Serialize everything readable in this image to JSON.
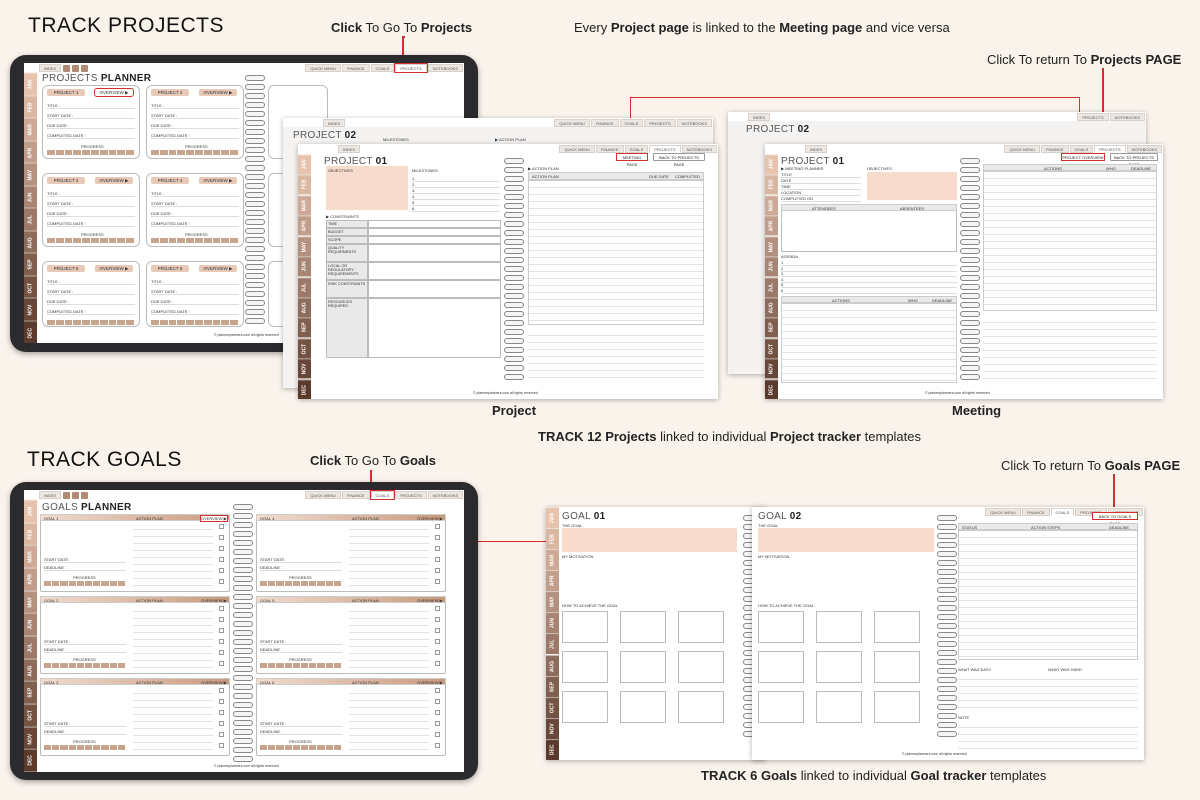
{
  "headings": {
    "projects": "TRACK PROJECTS",
    "goals": "TRACK GOALS"
  },
  "captions": {
    "click_projects_a": "Click",
    "click_projects_b": " To Go To ",
    "click_projects_c": "Projects",
    "linked_a": "Every ",
    "linked_b": "Project page",
    "linked_c": " is linked to the ",
    "linked_d": "Meeting page",
    "linked_e": " and vice versa",
    "return_projects_a": "Click To return To ",
    "return_projects_b": "Projects PAGE",
    "label_project": "Project",
    "label_meeting": "Meeting",
    "track12_a": "TRACK 12 ",
    "track12_b": "Projects",
    "track12_c": " linked to individual ",
    "track12_d": "Project tracker",
    "track12_e": " templates",
    "click_goals_a": "Click",
    "click_goals_b": " To Go To ",
    "click_goals_c": "Goals",
    "return_goals_a": "Click To return To ",
    "return_goals_b": "Goals PAGE",
    "track6_a": "TRACK 6 ",
    "track6_b": "Goals",
    "track6_c": " linked to individual ",
    "track6_d": "Goal tracker",
    "track6_e": " templates"
  },
  "nav": {
    "index": "INDEX",
    "quick_menu": "QUICK MENU",
    "finance": "FINANCE",
    "goals": "GOALS",
    "projects": "PROJECTS",
    "notebooks": "NOTEBOOKS"
  },
  "months": [
    "JAN",
    "FEB",
    "MAR",
    "APR",
    "MAY",
    "JUN",
    "JUL",
    "AUG",
    "SEP",
    "OCT",
    "NOV",
    "DEC"
  ],
  "projects_planner": {
    "title_a": "PROJECTS ",
    "title_b": "PLANNER",
    "cards": [
      "PROJECT 1",
      "PROJECT 2",
      "PROJECT 3",
      "PROJECT 4",
      "PROJECT 5",
      "PROJECT 6"
    ],
    "overview": "OVERVIEW ▶",
    "fields": [
      "TITLE :",
      "START DATE :",
      "DUE DATE :",
      "COMPLETED DATE :"
    ],
    "progress": "PROGRESS",
    "footer": "© planmeplanners.com   all rights reserved"
  },
  "project_page": {
    "title_a": "PROJECT ",
    "title_b": "01",
    "back_title_b": "02",
    "meeting_btn": "MEETING PAGE",
    "back_btn": "BACK TO PROJECTS PAGE",
    "objectives": "OBJECTIVES",
    "milestones": "MILESTONES",
    "milestone_nums": [
      "1.",
      "2.",
      "3.",
      "4.",
      "5.",
      "6."
    ],
    "constraints": "▶ CONSTRAINTS",
    "constraint_rows": [
      "TIME",
      "BUDGET",
      "SCOPE",
      "QUALITY REQUIRMENTS",
      "LOCAL OR REGULATORY REQUIREMENTS",
      "RISK CONSTRAINTS",
      "RESOURCES REQUIRED"
    ],
    "action_plan": "▶ ACTION PLAN",
    "cols": [
      "ACTION PLAN",
      "DUE DATE",
      "COMPLETED ON"
    ],
    "footer": "© planmeplanners.com   all rights reserved"
  },
  "meeting_page": {
    "title_a": "PROJECT ",
    "title_b": "01",
    "back_title_b": "02",
    "overview_btn": "PROJECT OVERVIEW",
    "back_btn": "BACK TO PROJECTS PAGE",
    "heading": "▶ MEETING PLANNER",
    "objectives": "OBJECTIVES",
    "fields": [
      "TITLE",
      "DATE",
      "TIME",
      "LOCATION",
      "COMPLETED ON"
    ],
    "attendees": "ATTENDEES",
    "absentees": "ABSENTEES",
    "agenda": "AGENDA",
    "agenda_nums": [
      "1",
      "2",
      "3",
      "4",
      "5",
      "6"
    ],
    "cols": [
      "ACTIONS",
      "WHO",
      "DEADLINE"
    ],
    "footer": "© planmeplanners.com   all rights reserved"
  },
  "goals_planner": {
    "title_a": "GOALS ",
    "title_b": "PLANNER",
    "cards": [
      "GOAL 1",
      "GOAL 4",
      "GOAL 2",
      "GOAL 5",
      "GOAL 3",
      "GOAL 6"
    ],
    "action_plan": "ACTION PLAN",
    "overview": "OVERVIEW ▶",
    "fields": [
      "START DATE :",
      "DEADLINE :"
    ],
    "progress": "PROGRESS",
    "footer": "© planmeplanners.com   all rights reserved"
  },
  "goal_page": {
    "title_a": "GOAL ",
    "g1": "01",
    "g2": "02",
    "the_goal": "THE GOAL",
    "motivation": "MY MOTIVATION",
    "how": "HOW TO ACHIEVE THE GOAL",
    "back_btn": "BACK TO GOALS PAGE",
    "cols": [
      "STATUS",
      "ACTION STEPS",
      "DEADLINE"
    ],
    "easy": "WHAT WAS EASY",
    "hard": "WHAT WAS HARD",
    "note": "NOTE",
    "footer": "© planmeplanners.com   all rights reserved"
  },
  "colors": {
    "accent": "#d32f2f",
    "tab_start": "#e7c3ad",
    "tab_end": "#5b3a2c",
    "peach": "#f7dccd"
  }
}
